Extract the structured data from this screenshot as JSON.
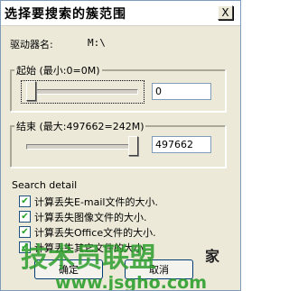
{
  "window": {
    "title": "选择要搜索的簇范围",
    "close_label": "X"
  },
  "drive": {
    "label": "驱动器名:",
    "value": "M:\\"
  },
  "start": {
    "legend": "起始 (最小:0=0M)",
    "value": "0",
    "slider_fraction": 0.0
  },
  "end": {
    "legend": "结束 (最大:497662=242M)",
    "value": "497662",
    "slider_fraction": 1.0
  },
  "search_detail": {
    "heading": "Search detail",
    "options": [
      {
        "label": "计算丢失E-mail文件的大小.",
        "checked": true
      },
      {
        "label": "计算丢失图像文件的大小.",
        "checked": true
      },
      {
        "label": "计算丢失Office文件的大小.",
        "checked": true
      },
      {
        "label": "计算丢失其它文件的大小.",
        "checked": true
      }
    ]
  },
  "buttons": {
    "ok": "确定",
    "cancel": "取消"
  },
  "watermark": {
    "brand": "技术员联盟",
    "site": "www.jsgho.com",
    "tag": "家"
  },
  "colors": {
    "window_bg": "#ece9d8",
    "watermark_green": "#2e9e2e"
  }
}
